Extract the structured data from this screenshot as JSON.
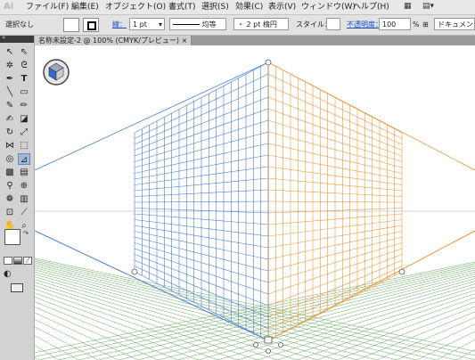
{
  "app": {
    "logo": "Ai"
  },
  "menu": {
    "items": [
      "ファイル(F)",
      "編集(E)",
      "オブジェクト(O)",
      "書式(T)",
      "選択(S)",
      "効果(C)",
      "表示(V)",
      "ウィンドウ(W)",
      "ヘルプ(H)"
    ]
  },
  "control": {
    "selection_state": "選択なし",
    "stroke_label": "線：",
    "stroke_weight": "1 pt",
    "profile_label": "均等",
    "brush_label": "・ 2 pt 楕円",
    "style_label": "スタイル：",
    "opacity_label": "不透明度：",
    "opacity_value": "100",
    "opacity_unit": "%",
    "document_setup": "ドキュメント設"
  },
  "document": {
    "tab_title": "名称未設定-2 @ 100% (CMYK/プレビュー)",
    "tab_close": "×"
  },
  "colors": {
    "left_grid": "#4a7fd6",
    "right_grid": "#f0963a",
    "ground_grid": "#6aaa63"
  },
  "icons": {
    "perspective_widget": "cube-icon",
    "collapse": "double-chevron-icon"
  }
}
